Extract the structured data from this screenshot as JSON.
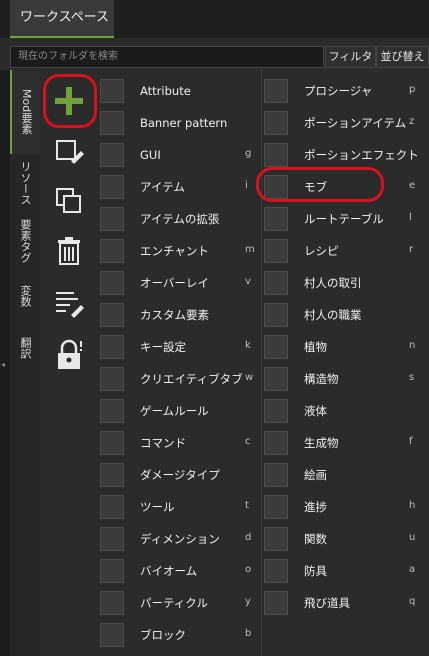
{
  "workspace_tab": "ワークスペース",
  "search": {
    "placeholder": "現在のフォルダを検索"
  },
  "buttons": {
    "filter": "フィルタ",
    "sort": "並び替え"
  },
  "vertical_tabs": [
    "Mod要素",
    "リソース",
    "要素タグ",
    "変数",
    "翻訳"
  ],
  "left_elements": [
    {
      "label": "Attribute",
      "key": "",
      "icon": "attribute-icon"
    },
    {
      "label": "Banner pattern",
      "key": "",
      "icon": "banner-icon"
    },
    {
      "label": "GUI",
      "key": "g",
      "icon": "gui-icon"
    },
    {
      "label": "アイテム",
      "key": "i",
      "icon": "diamond-icon"
    },
    {
      "label": "アイテムの拡張",
      "key": "",
      "icon": "item-extension-icon"
    },
    {
      "label": "エンチャント",
      "key": "m",
      "icon": "enchant-icon"
    },
    {
      "label": "オーバーレイ",
      "key": "v",
      "icon": "overlay-icon"
    },
    {
      "label": "カスタム要素",
      "key": "",
      "icon": "custom-element-icon"
    },
    {
      "label": "キー設定",
      "key": "k",
      "icon": "keybind-icon"
    },
    {
      "label": "クリエイティブタブ",
      "key": "w",
      "icon": "tab-icon"
    },
    {
      "label": "ゲームルール",
      "key": "",
      "icon": "gamerule-icon"
    },
    {
      "label": "コマンド",
      "key": "c",
      "icon": "command-icon"
    },
    {
      "label": "ダメージタイプ",
      "key": "",
      "icon": "damage-type-icon"
    },
    {
      "label": "ツール",
      "key": "t",
      "icon": "pickaxe-icon"
    },
    {
      "label": "ディメンション",
      "key": "d",
      "icon": "dimension-icon"
    },
    {
      "label": "バイオーム",
      "key": "o",
      "icon": "biome-icon"
    },
    {
      "label": "パーティクル",
      "key": "y",
      "icon": "particle-icon"
    },
    {
      "label": "ブロック",
      "key": "b",
      "icon": "block-icon"
    }
  ],
  "right_elements": [
    {
      "label": "プロシージャ",
      "key": "p",
      "icon": "procedure-icon"
    },
    {
      "label": "ポーションアイテム",
      "key": "z",
      "icon": "potion-icon"
    },
    {
      "label": "ポーションエフェクト",
      "key": "",
      "icon": "potion-effect-icon"
    },
    {
      "label": "モブ",
      "key": "e",
      "icon": "mob-icon"
    },
    {
      "label": "ルートテーブル",
      "key": "l",
      "icon": "loot-table-icon"
    },
    {
      "label": "レシピ",
      "key": "r",
      "icon": "recipe-icon"
    },
    {
      "label": "村人の取引",
      "key": "",
      "icon": "villager-trade-icon"
    },
    {
      "label": "村人の職業",
      "key": "",
      "icon": "villager-profession-icon"
    },
    {
      "label": "植物",
      "key": "n",
      "icon": "plant-icon"
    },
    {
      "label": "構造物",
      "key": "s",
      "icon": "structure-icon"
    },
    {
      "label": "液体",
      "key": "",
      "icon": "fluid-icon"
    },
    {
      "label": "生成物",
      "key": "f",
      "icon": "feature-icon"
    },
    {
      "label": "絵画",
      "key": "",
      "icon": "painting-icon"
    },
    {
      "label": "進捗",
      "key": "h",
      "icon": "advancement-icon"
    },
    {
      "label": "関数",
      "key": "u",
      "icon": "function-icon"
    },
    {
      "label": "防具",
      "key": "a",
      "icon": "armor-icon"
    },
    {
      "label": "飛び道具",
      "key": "q",
      "icon": "projectile-icon"
    }
  ],
  "accent_color": "#6fa23a",
  "highlight_color": "#d8121d",
  "arrow_glyph": "◂"
}
